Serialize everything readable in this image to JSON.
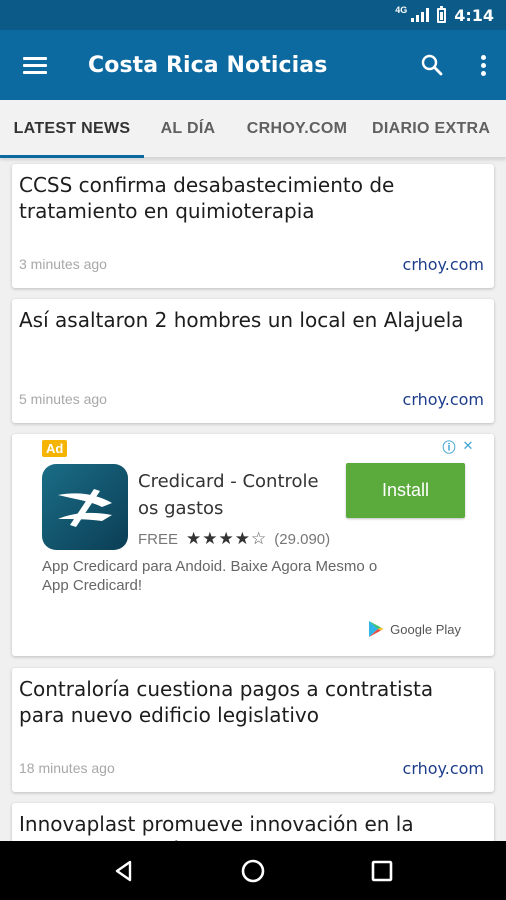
{
  "status_bar": {
    "network": "4G",
    "time": "4:14"
  },
  "app_bar": {
    "title": "Costa Rica Noticias"
  },
  "tabs": [
    {
      "label": "LATEST NEWS",
      "active": true
    },
    {
      "label": "AL DÍA",
      "active": false
    },
    {
      "label": "CRHOY.COM",
      "active": false
    },
    {
      "label": "DIARIO EXTRA",
      "active": false
    }
  ],
  "articles": [
    {
      "headline": "CCSS confirma desabastecimiento de tratamiento en quimioterapia",
      "time": "3 minutes ago",
      "source": "crhoy.com"
    },
    {
      "headline": "Así asaltaron 2 hombres un local en Alajuela",
      "time": "5 minutes ago",
      "source": "crhoy.com"
    },
    {
      "headline": "Contraloría cuestiona pagos a contratista para nuevo edificio legislativo",
      "time": "18 minutes ago",
      "source": "crhoy.com"
    },
    {
      "headline": "Innovaplast promueve innovación en la industria del plástico"
    }
  ],
  "ad": {
    "badge": "Ad",
    "title": "Credicard - Controle os gastos",
    "price": "FREE",
    "rating": 4,
    "rating_max": 5,
    "rating_count": "(29.090)",
    "install_label": "Install",
    "body": "App Credicard para Andoid. Baixe Agora Mesmo o App Credicard!",
    "store": "Google Play",
    "colors": {
      "install": "#5aaa3c",
      "badge": "#f4b400"
    }
  },
  "colors": {
    "app_bar": "#0d6aa1",
    "status_bar": "#0b5a87",
    "source_link": "#1e3d8a"
  }
}
